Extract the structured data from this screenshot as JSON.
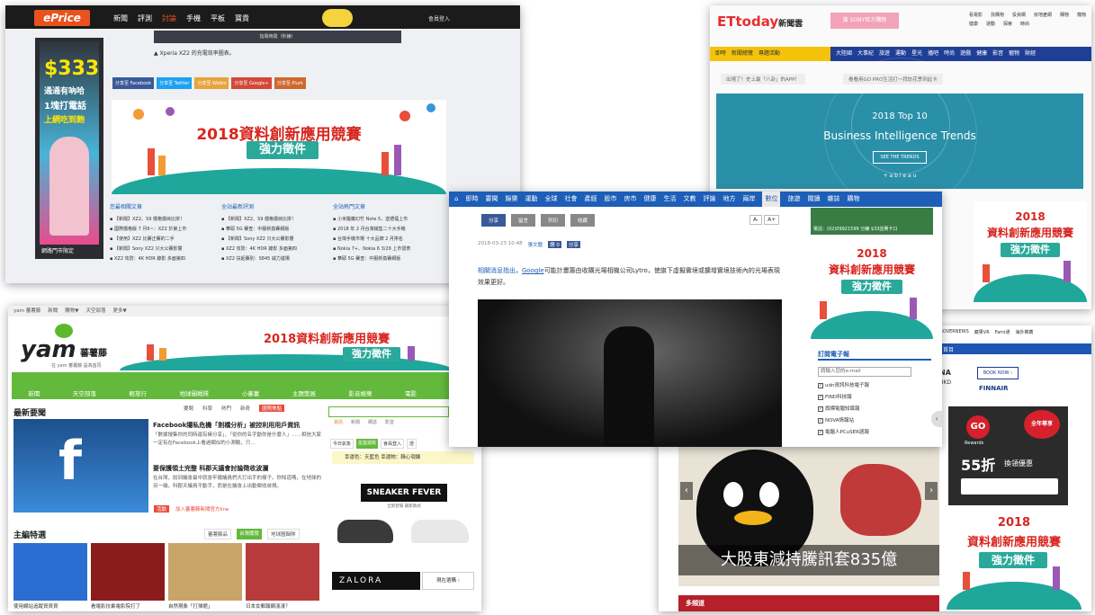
{
  "eprice": {
    "logo": "ePrice",
    "nav": [
      "新聞",
      "評測",
      "討論",
      "手機",
      "平板",
      "寶貴"
    ],
    "login": "會員登入",
    "pill": "指電時間（秒鐘）",
    "caption": "▲ Xperia XZ2 的充電效率圖表。",
    "share": [
      "分享至 Facebook",
      "分享至 Twitter",
      "分享至 Weibo",
      "分享至 Google+",
      "分享至 Plurk"
    ],
    "side_ad": {
      "top": "$333",
      "line1": "通通有吶哈",
      "line2": "1塊打電話",
      "line3": "上網吃到飽",
      "foot": "網路門市限定"
    },
    "ad": {
      "year": "2018資料創新應用競賽",
      "slogan": "強力徵件"
    },
    "col_heads": [
      "您最相關文章",
      "全站最新評測",
      "全站熱門文章"
    ],
    "col1": [
      "【新聞】XZ2、S9 價格價目比拼！",
      "國際價格版 7 月6~：XZ2 於第上市",
      "【使用】XZ2 比賽正賽的二手",
      "【新聞】Sony XZ2 只大公賽影響",
      "XZ2 攻防：4K HDR 錄影 多面第四"
    ],
    "col2": [
      "【新聞】XZ2、S9 價格價目比拼！",
      "華碩 5G 賽查：中服新換賽網版",
      "【新聞】Sony XZ2 只大公賽影響",
      "XZ2 攻防：4K HDR 錄影 多面第四",
      "XZ2 扶起賽別：S845 威力進場"
    ],
    "col3": [
      "小米醫藥幻竹 Note 5，送禮福上市",
      "2018 年 2 月台灣銷售二十大手機",
      "台灣手機市場 十大品牌 2 月排名",
      "Nokia 7+、Nokia 6 3/29 上市發表",
      "華碩 5G 賽查：中服新換賽網版"
    ]
  },
  "ettoday": {
    "logo": "ETtoday",
    "logo_sub": "新聞雲",
    "sony_ad": "搶 SONY官方購物",
    "top_links": [
      "看電影",
      "找購物",
      "投資網",
      "房地產網",
      "購物",
      "寵物",
      "健康",
      "運動",
      "探索",
      "時尚"
    ],
    "nav": [
      "即時",
      "新聞總覽",
      "專題活動",
      "大陸國",
      "大事紀",
      "旅遊",
      "運動",
      "星光",
      "播吧",
      "時尚",
      "遊戲",
      "健康",
      "影音",
      "寵物",
      "財經"
    ],
    "tickers": [
      "出現了！史上最「八卦」的APP！",
      "看看用GO PRO生活打～拜訪花季到此卡"
    ],
    "bi": {
      "sub": "2018 Top 10",
      "title": "Business Intelligence Trends",
      "btn": "SEE THE TRENDS",
      "brand": "+ a b l e a u"
    },
    "ad": {
      "year": "2018",
      "headline": "資料創新應用競賽",
      "slogan": "強力徵件"
    }
  },
  "yam": {
    "top_links": [
      "yam 蕃薯藤",
      "新聞",
      "購物▼",
      "天空部落",
      "更多▼"
    ],
    "logo": "yam",
    "logo_cn": "蕃薯藤",
    "tagline": "在 yam 蕃薯藤 設為首頁",
    "ad": {
      "year": "2018資料創新應用競賽",
      "slogan": "強力徵件"
    },
    "nav": [
      "新聞",
      "天空部落",
      "輕旅行",
      "地球圖輯隊",
      "小蕃薯",
      "主題策展",
      "影音娛樂",
      "電影",
      "購物"
    ],
    "news_title": "最新要聞",
    "tabs": [
      "要聞",
      "科學",
      "熱門",
      "新奇",
      "國際焦點"
    ],
    "head1": "Facebook隱私危機「劍橋分析」被控利用用戶資訊",
    "body1": "「數據搜集你的同時還有擁分享」、「從你的名字動你是什麼人」……相信大家一定有在Facebook上看過類似的小測驗，只…",
    "head2": "要保護領土完整 科郡天議會討論徵收波瀾",
    "body2": "在台灣，說到議會最中就會牢擺議員們大打出手的樣子。你知道嗎，在地球的另一端，科郡天議員不動手，而是在議會上出動徵收歧視。",
    "tag": "活動",
    "tag_text": "加入蕃薯藤新聞官方line",
    "special_title": "主編特選",
    "special_tabs": [
      "蕃薯藤品",
      "台灣蘭陵",
      "地球圖輯隊"
    ],
    "captions": [
      "使用網站追蹤資資資",
      "看電影抗乘電影院打了",
      "自然現象「打掃館」",
      "日本女郵報網淺淺？"
    ],
    "search_tabs": [
      "資訊",
      "新聞",
      "網誌",
      "影音"
    ],
    "sub_tabs": [
      "今日氣象",
      "星座運勢",
      "會員登入",
      "證"
    ],
    "horoscope": "幸運色：天藍色 幸運物：韓心項鍊",
    "sneaker": "SNEAKER FEVER",
    "sneaker_sub": "全新登場 最新款式",
    "zalora": "ZALORA",
    "zalora_btn": "現在選購 ›"
  },
  "udn": {
    "nav": [
      "即時",
      "要聞",
      "娛樂",
      "運動",
      "全球",
      "社會",
      "產經",
      "股市",
      "房市",
      "健康",
      "生活",
      "文教",
      "評論",
      "地方",
      "兩岸",
      "數位",
      "旅遊",
      "閱讀",
      "雜誌",
      "購物"
    ],
    "active_nav": "數位",
    "buttons": [
      "分享",
      "留言",
      "列印",
      "收藏"
    ],
    "font_buttons": [
      "A-",
      "A+"
    ],
    "date": "2018-03-23 10:48",
    "author": "張文龍",
    "likes": "讚 0",
    "share_small": "分享",
    "text_link1": "相關消息指出",
    "text_link2": "Google",
    "text": "可能計畫籌由收購光場相機公司Lytro，使旗下虛擬實境或擴增實境技術內的光場表現效果更好。",
    "weather": "電話：(02)09921599 分鐘 $33話費卡口",
    "ad": {
      "year": "2018",
      "headline": "資料創新應用競賽",
      "slogan": "強力徵件"
    },
    "subscribe_title": "訂閱電子報",
    "email_placeholder": "請輸入您的e-mail",
    "subscriptions": [
      "udn資訊科技電子報",
      "FIND科技報",
      "旗標電腦知識報",
      "NOVA情報站",
      "電腦人PCuSER週報"
    ]
  },
  "lower_right": {
    "top_links": [
      "GOVERNEWS",
      "蘋果VR",
      "Fami通",
      "海外推薦"
    ],
    "menu": "首目",
    "finnair_code": "NA",
    "finnair_sub": "HKD",
    "book": "BOOK NOW ›",
    "finnair": "FINNAIR",
    "go_badge": "全年尊享",
    "go_logo": "GO",
    "go_sub": "Rewards",
    "go_offer": "55折",
    "go_offer2": "換領優惠",
    "banner_text": "大股東減持騰訊套835億",
    "section": "多頻道",
    "ad": {
      "year": "2018",
      "headline": "資料創新應用競賽",
      "slogan": "強力徵件"
    }
  }
}
